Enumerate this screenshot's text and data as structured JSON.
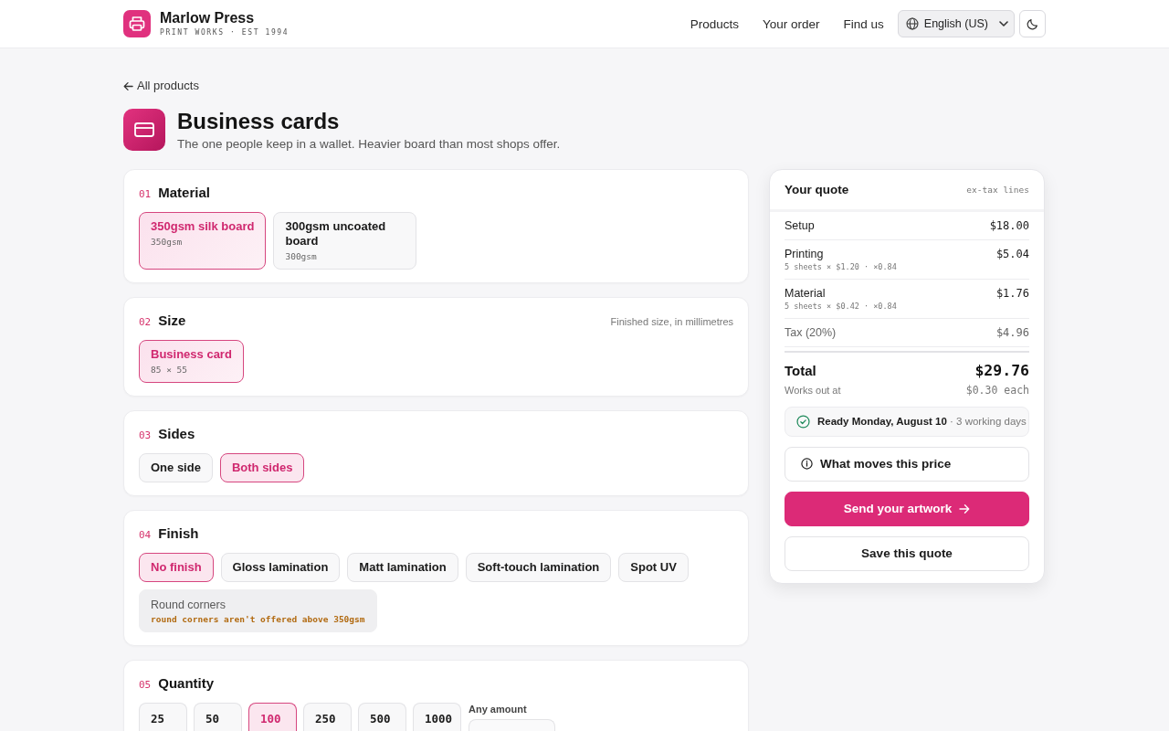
{
  "header": {
    "brand": {
      "name": "Marlow Press",
      "tagline": "PRINT WORKS · EST 1994"
    },
    "nav": [
      {
        "label": "Products"
      },
      {
        "label": "Your order"
      },
      {
        "label": "Find us"
      }
    ],
    "language": {
      "value": "English (US)"
    }
  },
  "back_link": "All products",
  "product": {
    "title": "Business cards",
    "subtitle": "The one people keep in a wallet. Heavier board than most shops offer."
  },
  "sections": [
    {
      "number": "01",
      "title": "Material",
      "kind": "tile",
      "options": [
        {
          "label": "350gsm silk board",
          "detail": "350gsm",
          "selected": true
        },
        {
          "label": "300gsm uncoated board",
          "detail": "300gsm",
          "selected": false
        }
      ]
    },
    {
      "number": "02",
      "title": "Size",
      "kind": "tile",
      "hint": "Finished size, in millimetres",
      "options": [
        {
          "label": "Business card",
          "detail": "85 × 55",
          "selected": true
        }
      ]
    },
    {
      "number": "03",
      "title": "Sides",
      "kind": "pill",
      "options": [
        {
          "label": "One side",
          "selected": false
        },
        {
          "label": "Both sides",
          "selected": true
        }
      ]
    },
    {
      "number": "04",
      "title": "Finish",
      "kind": "pill",
      "options": [
        {
          "label": "No finish",
          "selected": true
        },
        {
          "label": "Gloss lamination",
          "selected": false
        },
        {
          "label": "Matt lamination",
          "selected": false
        },
        {
          "label": "Soft-touch lamination",
          "selected": false
        },
        {
          "label": "Spot UV",
          "selected": false
        }
      ],
      "extras": [
        {
          "label": "Round corners",
          "note": "round corners aren't offered above 350gsm",
          "disabled": true
        }
      ]
    },
    {
      "number": "05",
      "title": "Quantity",
      "kind": "amount",
      "options": [
        {
          "label": "25",
          "selected": false
        },
        {
          "label": "50",
          "selected": false
        },
        {
          "label": "100",
          "selected": true
        },
        {
          "label": "250",
          "selected": false
        },
        {
          "label": "500",
          "selected": false
        },
        {
          "label": "1000",
          "selected": false
        }
      ],
      "custom": {
        "label": "Any amount"
      }
    }
  ],
  "quote": {
    "title": "Your quote",
    "note": "ex-tax lines",
    "lines": [
      {
        "label": "Setup",
        "amount": "$18.00",
        "kind": "charge"
      },
      {
        "label": "Printing",
        "detail": "5 sheets × $1.20 · ×0.84",
        "amount": "$5.04",
        "kind": "charge"
      },
      {
        "label": "Material",
        "detail": "5 sheets × $0.42 · ×0.84",
        "amount": "$1.76",
        "kind": "charge"
      },
      {
        "label": "Tax (20%)",
        "amount": "$4.96",
        "kind": "tax"
      }
    ],
    "total": {
      "label": "Total",
      "amount": "$29.76",
      "unit_label": "Works out at",
      "unit_price": "$0.30 each"
    },
    "ready": "**Ready Monday, August 10** · 3 working days",
    "buttons": [
      {
        "label": "What moves this price",
        "kind": "info"
      },
      {
        "label": "Send your artwork",
        "kind": "primary"
      },
      {
        "label": "Save this quote",
        "kind": "secondary"
      }
    ]
  }
}
